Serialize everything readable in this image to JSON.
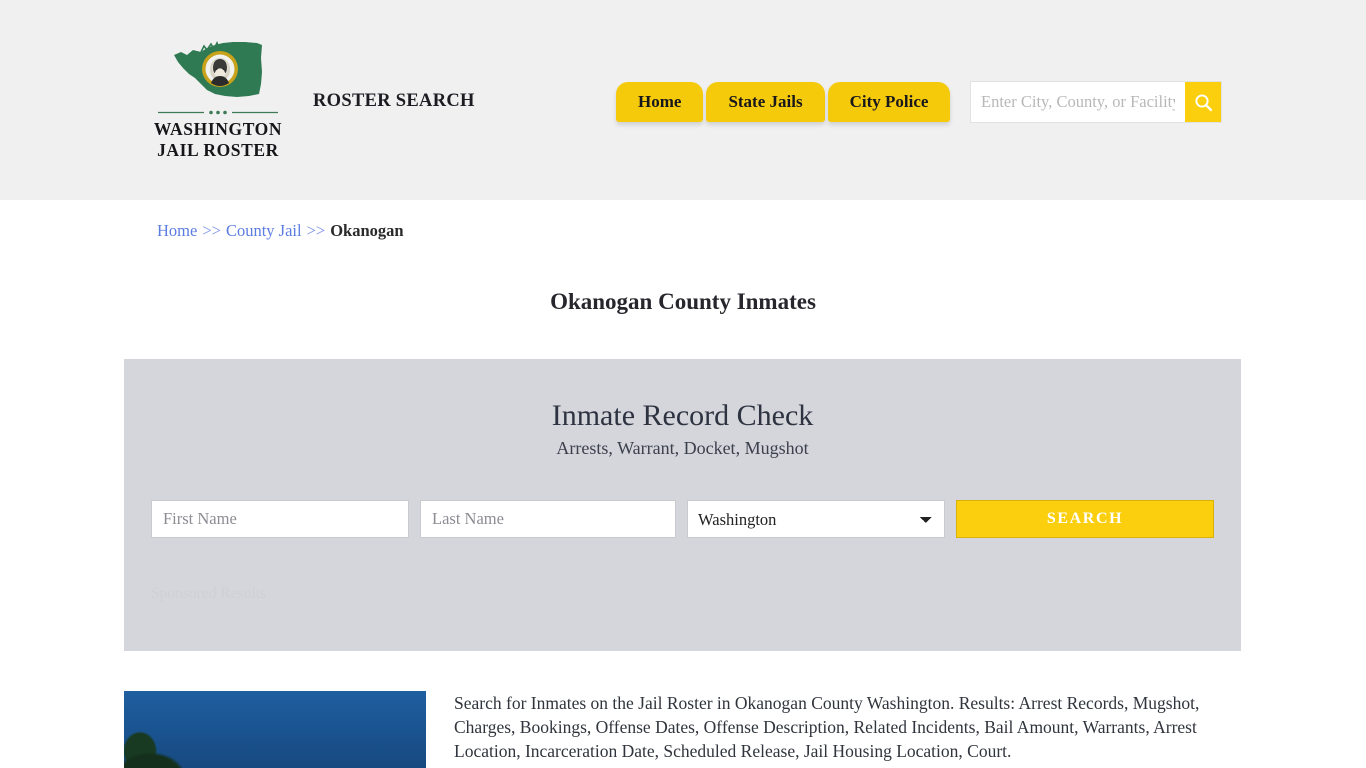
{
  "header": {
    "logo": {
      "icon": "washington-state-flag-seal",
      "line1": "WASHINGTON",
      "line2": "JAIL ROSTER"
    },
    "tagline": "ROSTER SEARCH",
    "nav": [
      {
        "label": "Home"
      },
      {
        "label": "State Jails"
      },
      {
        "label": "City Police"
      }
    ],
    "search": {
      "placeholder": "Enter City, County, or Facility",
      "value": "",
      "button_icon": "search-icon"
    },
    "background_color": "#f0f0f0",
    "accent_color": "#f5ca0a"
  },
  "breadcrumb": {
    "home": "Home",
    "sep1": ">>",
    "county_jail": "County Jail",
    "sep2": ">>",
    "current": "Okanogan"
  },
  "page_title": "Okanogan County Inmates",
  "panel": {
    "title": "Inmate Record Check",
    "subtitle": "Arrests, Warrant, Docket, Mugshot",
    "first_name_placeholder": "First Name",
    "first_name_value": "",
    "last_name_placeholder": "Last Name",
    "last_name_value": "",
    "state_selected": "Washington",
    "state_options": [
      "Washington"
    ],
    "search_button": "SEARCH",
    "sponsored_label": "Sponsored Results",
    "background_color": "#d5d6db"
  },
  "content": {
    "thumbnail_alt": "okanogan-county-jail-photo",
    "description": "Search for Inmates on the Jail Roster in Okanogan County Washington. Results: Arrest Records, Mugshot, Charges, Bookings, Offense Dates, Offense Description, Related Incidents, Bail Amount, Warrants, Arrest Location, Incarceration Date, Scheduled Release, Jail Housing Location, Court."
  }
}
